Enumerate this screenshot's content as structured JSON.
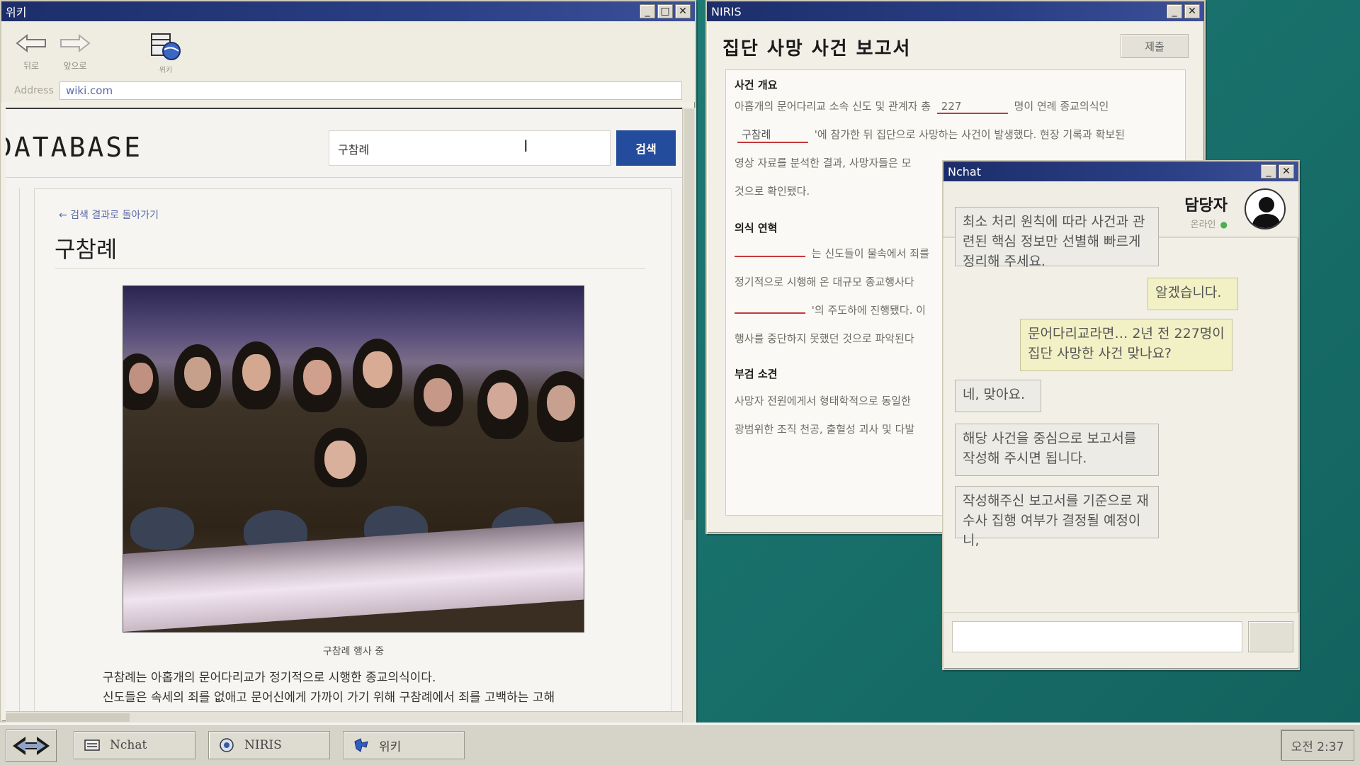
{
  "wiki": {
    "window_title": "위키",
    "toolbar": {
      "back": "뒤로",
      "forward": "앞으로",
      "wiki": "위키"
    },
    "address_label": "Address",
    "address": "wiki.com",
    "db_title": "DATABASE",
    "search_value": "구참례",
    "search_button": "검색",
    "back_link": "← 검색 결과로 돌아가기",
    "article_title": "구참례",
    "photo_caption": "구참례 행사 중",
    "body_lines": [
      "구참례는 아홉개의 문어다리교가 정기적으로 시행한 종교의식이다.",
      "신도들은 속세의 죄를 없애고 문어신에게 가까이 가기 위해 구참례에서 죄를 고백하는 고해"
    ]
  },
  "niris": {
    "window_title": "NIRIS",
    "report_title": "집단 사망 사건 보고서",
    "submit": "제출",
    "sections": {
      "overview": "사건 개요",
      "history": "의식 연혁",
      "autopsy": "부검 소견"
    },
    "overview_lines": {
      "l1_pre": "아홉개의 문어다리교 소속 신도 및 관계자 총",
      "l1_blank": "227",
      "l1_post": "명이 연례 종교의식인",
      "l2_blank": "구참례",
      "l2_post": "'에 참가한 뒤 집단으로 사망하는 사건이 발생했다. 현장 기록과 확보된",
      "l3": "영상 자료를 분석한 결과, 사망자들은 모",
      "l4": "것으로 확인됐다."
    },
    "history_lines": {
      "l1_post": "는 신도들이 물속에서 죄를",
      "l2": "정기적으로 시행해 온 대규모 종교행사다",
      "l3_post": "'의 주도하에 진행됐다. 이",
      "l4": "행사를 중단하지 못했던 것으로 파악된다"
    },
    "autopsy_lines": {
      "l1": "사망자 전원에게서 형태학적으로 동일한",
      "l2": "광범위한 조직 천공, 출혈성 괴사 및 다발"
    }
  },
  "nchat": {
    "window_title": "Nchat",
    "contact_name": "담당자",
    "contact_status": "온라인",
    "messages": [
      {
        "dir": "in",
        "text": "최소 처리 원칙에 따라 사건과 관련된 핵심 정보만 선별해 빠르게 정리해 주세요."
      },
      {
        "dir": "out",
        "text": "알겠습니다."
      },
      {
        "dir": "out",
        "text": "문어다리교라면… 2년 전 227명이 집단 사망한 사건 맞나요?"
      },
      {
        "dir": "in",
        "text": "네, 맞아요."
      },
      {
        "dir": "in",
        "text": "해당 사건을 중심으로 보고서를 작성해 주시면 됩니다."
      },
      {
        "dir": "in",
        "text": "작성해주신 보고서를 기준으로 재수사 집행 여부가 결정될 예정이니,"
      }
    ],
    "input_value": ""
  },
  "taskbar": {
    "items": [
      {
        "label": "Nchat",
        "icon": "chat-keyboard-icon"
      },
      {
        "label": "NIRIS",
        "icon": "niris-icon"
      },
      {
        "label": "위키",
        "icon": "wiki-puzzle-icon"
      }
    ],
    "clock": "오전 2:37"
  }
}
